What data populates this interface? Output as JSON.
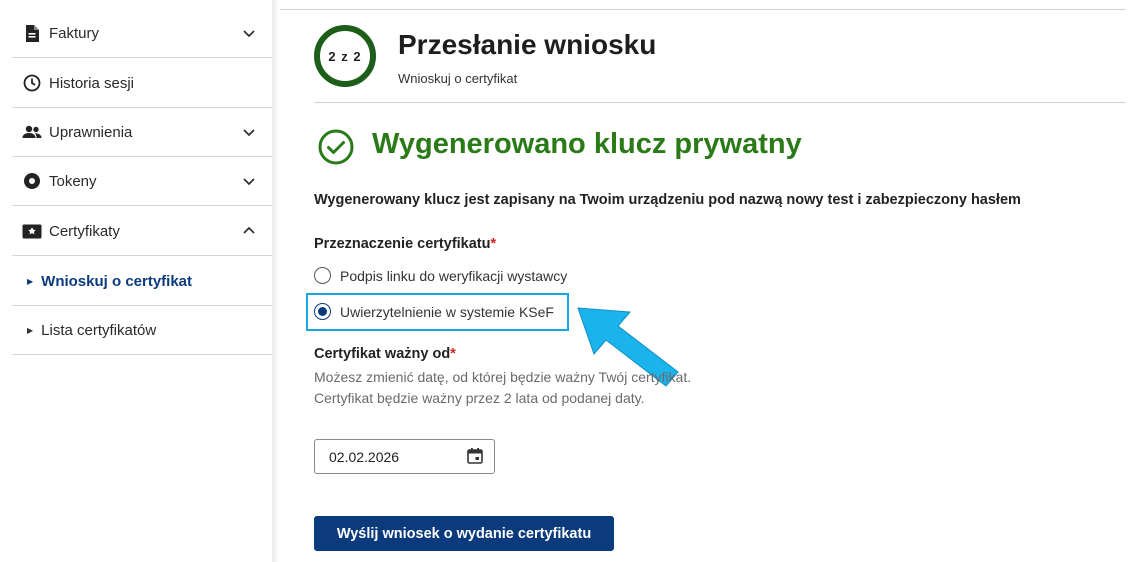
{
  "sidebar": {
    "items": [
      {
        "label": "Faktury",
        "icon": "document-icon",
        "chevron": "down"
      },
      {
        "label": "Historia sesji",
        "icon": "clock-icon",
        "chevron": ""
      },
      {
        "label": "Uprawnienia",
        "icon": "users-icon",
        "chevron": "down"
      },
      {
        "label": "Tokeny",
        "icon": "token-icon",
        "chevron": "down"
      },
      {
        "label": "Certyfikaty",
        "icon": "certificate-icon",
        "chevron": "up"
      }
    ],
    "sub_items": [
      {
        "label": "Wnioskuj o certyfikat",
        "active": true
      },
      {
        "label": "Lista certyfikatów",
        "active": false
      }
    ]
  },
  "step": {
    "indicator": "2 z 2",
    "title": "Przesłanie wniosku",
    "subtitle": "Wnioskuj o certyfikat"
  },
  "success": {
    "title": "Wygenerowano klucz prywatny",
    "info": "Wygenerowany klucz jest zapisany na Twoim urządzeniu pod nazwą nowy test i zabezpieczony hasłem"
  },
  "purpose": {
    "label": "Przeznaczenie certyfikatu",
    "required_mark": "*",
    "options": [
      {
        "label": "Podpis linku do weryfikacji wystawcy",
        "checked": false
      },
      {
        "label": "Uwierzytelnienie w systemie KSeF",
        "checked": true
      }
    ]
  },
  "valid_from": {
    "label": "Certyfikat ważny od",
    "required_mark": "*",
    "help": "Możesz zmienić datę, od której będzie ważny Twój certyfikat. Certyfikat będzie ważny przez 2 lata od podanej daty.",
    "value": "02.02.2026"
  },
  "submit_label": "Wyślij wniosek o wydanie certyfikatu",
  "colors": {
    "primary": "#0b3a7d",
    "success": "#2b7a18",
    "step_ring": "#1d5e1b",
    "highlight": "#18a7e0",
    "required": "#d3232a"
  }
}
